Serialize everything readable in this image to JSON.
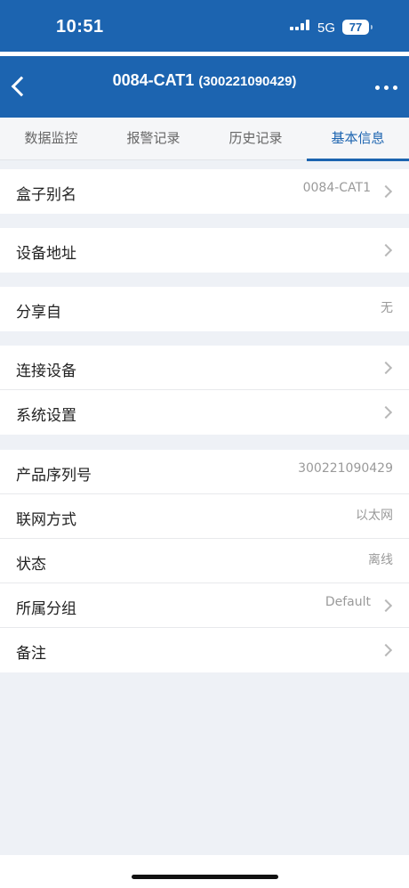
{
  "status_bar": {
    "time": "10:51",
    "network": "5G",
    "battery": "77"
  },
  "header": {
    "title": "0084-CAT1",
    "subtitle": "(300221090429)"
  },
  "tabs": [
    {
      "label": "数据监控"
    },
    {
      "label": "报警记录"
    },
    {
      "label": "历史记录"
    },
    {
      "label": "基本信息",
      "active": true
    }
  ],
  "info": {
    "alias": {
      "label": "盒子别名",
      "value": "0084-CAT1"
    },
    "address": {
      "label": "设备地址"
    },
    "shared_from": {
      "label": "分享自",
      "value": "无"
    },
    "connected_devices": {
      "label": "连接设备"
    },
    "system_settings": {
      "label": "系统设置"
    },
    "serial": {
      "label": "产品序列号",
      "value": "300221090429"
    },
    "network_mode": {
      "label": "联网方式",
      "value": "以太网"
    },
    "status": {
      "label": "状态",
      "value": "离线"
    },
    "group": {
      "label": "所属分组",
      "value": "Default"
    },
    "remark": {
      "label": "备注"
    }
  },
  "colors": {
    "primary": "#1c64b0",
    "background": "#eef1f6"
  }
}
